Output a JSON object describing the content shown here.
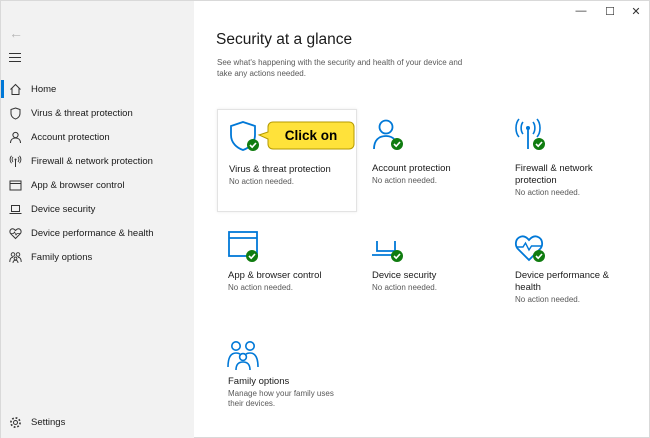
{
  "window": {
    "minimize_symbol": "—",
    "maximize_symbol": "☐",
    "close_symbol": "✕",
    "back_symbol": "←"
  },
  "sidebar": {
    "items": [
      {
        "label": "Home",
        "icon": "home-icon",
        "active": true
      },
      {
        "label": "Virus & threat protection",
        "icon": "shield-icon",
        "active": false
      },
      {
        "label": "Account protection",
        "icon": "person-icon",
        "active": false
      },
      {
        "label": "Firewall & network protection",
        "icon": "antenna-icon",
        "active": false
      },
      {
        "label": "App & browser control",
        "icon": "browser-icon",
        "active": false
      },
      {
        "label": "Device security",
        "icon": "laptop-icon",
        "active": false
      },
      {
        "label": "Device performance & health",
        "icon": "heart-icon",
        "active": false
      },
      {
        "label": "Family options",
        "icon": "family-icon",
        "active": false
      }
    ],
    "settings_label": "Settings"
  },
  "main": {
    "title": "Security at a glance",
    "subtitle": "See what's happening with the security and health of your device and take any actions needed.",
    "tiles": [
      {
        "name": "Virus & threat protection",
        "status": "No action needed.",
        "icon": "shield-check-icon"
      },
      {
        "name": "Account protection",
        "status": "No action needed.",
        "icon": "person-check-icon"
      },
      {
        "name": "Firewall & network protection",
        "status": "No action needed.",
        "icon": "antenna-check-icon"
      },
      {
        "name": "App & browser control",
        "status": "No action needed.",
        "icon": "browser-check-icon"
      },
      {
        "name": "Device security",
        "status": "No action needed.",
        "icon": "laptop-check-icon"
      },
      {
        "name": "Device performance & health",
        "status": "No action needed.",
        "icon": "heart-check-icon"
      },
      {
        "name": "Family options",
        "status": "Manage how your family uses their devices.",
        "icon": "family-icon"
      }
    ]
  },
  "callout": {
    "text": "Click on"
  },
  "colors": {
    "accent": "#0078d7",
    "ok_green": "#107c10",
    "callout_fill": "#ffe23a",
    "callout_border": "#b59a00"
  }
}
